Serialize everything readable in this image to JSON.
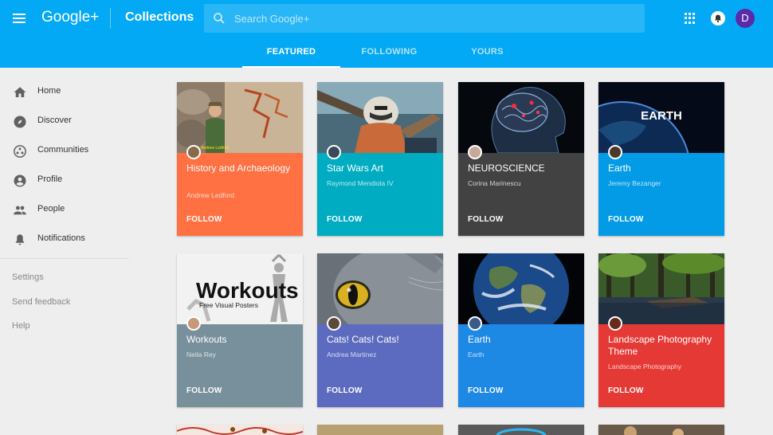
{
  "header": {
    "logo": "Google+",
    "page_title": "Collections",
    "search_placeholder": "Search Google+",
    "avatar_initial": "D"
  },
  "tabs": [
    {
      "label": "FEATURED",
      "active": true
    },
    {
      "label": "FOLLOWING",
      "active": false
    },
    {
      "label": "YOURS",
      "active": false
    }
  ],
  "sidebar": {
    "items": [
      {
        "label": "Home",
        "icon": "home-icon"
      },
      {
        "label": "Discover",
        "icon": "compass-icon"
      },
      {
        "label": "Communities",
        "icon": "communities-icon"
      },
      {
        "label": "Profile",
        "icon": "profile-icon"
      },
      {
        "label": "People",
        "icon": "people-icon"
      },
      {
        "label": "Notifications",
        "icon": "bell-icon"
      }
    ],
    "links": [
      "Settings",
      "Send feedback",
      "Help"
    ]
  },
  "cards": [
    {
      "title": "History and Archaeology",
      "owner": "Andrew Ledford",
      "follow": "FOLLOW",
      "color": "#ff7043"
    },
    {
      "title": "Star Wars Art",
      "owner": "Raymond Mendiola IV",
      "follow": "FOLLOW",
      "color": "#00acc1"
    },
    {
      "title": "NEUROSCIENCE",
      "owner": "Corina Marinescu",
      "follow": "FOLLOW",
      "color": "#424242"
    },
    {
      "title": "Earth",
      "owner": "Jeremy Bezanger",
      "follow": "FOLLOW",
      "color": "#039be5"
    },
    {
      "title": "Workouts",
      "owner": "Neila Rey",
      "follow": "FOLLOW",
      "color": "#78909c"
    },
    {
      "title": "Cats! Cats! Cats!",
      "owner": "Andrea Martinez",
      "follow": "FOLLOW",
      "color": "#5c6bc0"
    },
    {
      "title": "Earth",
      "owner": "Earth",
      "follow": "FOLLOW",
      "color": "#1e88e5"
    },
    {
      "title": "Landscape Photography Theme",
      "owner": "Landscape Photography",
      "follow": "FOLLOW",
      "color": "#e53935"
    }
  ],
  "image_text": {
    "earth_logo": "EARTH",
    "workouts_title": "Workouts",
    "workouts_subtitle": "Free Visual Posters",
    "history_caption": "Andrew Ledford"
  }
}
